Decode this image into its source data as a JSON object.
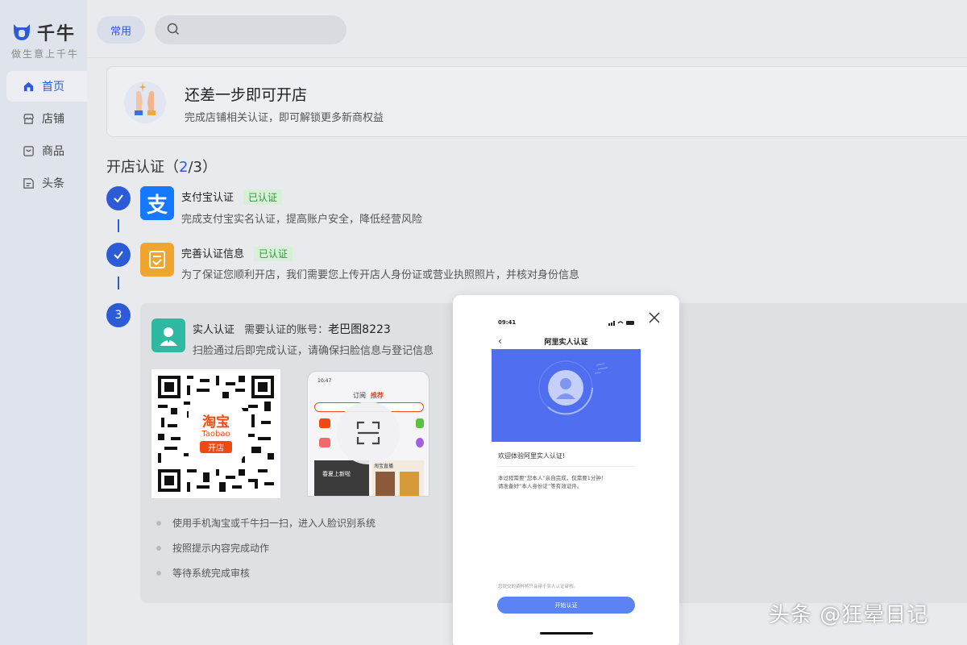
{
  "brand": {
    "name": "千牛",
    "slogan": "做生意上千牛"
  },
  "sidebar": {
    "items": [
      {
        "label": "首页",
        "icon": "home-icon",
        "active": true
      },
      {
        "label": "店铺",
        "icon": "store-icon",
        "active": false
      },
      {
        "label": "商品",
        "icon": "product-icon",
        "active": false
      },
      {
        "label": "头条",
        "icon": "news-icon",
        "active": false
      }
    ]
  },
  "topbar": {
    "chip_label": "常用",
    "search_value": ""
  },
  "banner": {
    "title": "还差一步即可开店",
    "subtitle": "完成店铺相关认证，即可解锁更多新商权益"
  },
  "section": {
    "title_prefix": "开店认证（",
    "done": "2",
    "title_suffix": "/3）"
  },
  "steps": [
    {
      "title": "支付宝认证",
      "badge": "已认证",
      "desc": "完成支付宝实名认证，提高账户安全，降低经营风险",
      "icon_glyph": "支"
    },
    {
      "title": "完善认证信息",
      "badge": "已认证",
      "desc": "为了保证您顺利开店，我们需要您上传开店人身份证或营业执照照片，并核对身份信息"
    },
    {
      "number": "3",
      "title": "实人认证",
      "account_label": "需要认证的账号：",
      "account": "老巴图8223",
      "desc": "扫脸通过后即完成认证，请确保扫脸信息与登记信息"
    }
  ],
  "qr": {
    "logo_cn": "淘宝",
    "logo_en": "Taobao",
    "logo_tag": "开店"
  },
  "phone_mock": {
    "time": "10:47",
    "tab1": "订阅",
    "tab2": "推荐",
    "banner_text": "春夏上新啦",
    "live": "淘宝直播"
  },
  "tips": [
    "使用手机淘宝或千牛扫一扫，进入人脸识别系统",
    "按照提示内容完成动作",
    "等待系统完成审核"
  ],
  "modal": {
    "status_time": "09:41",
    "title": "阿里实人认证",
    "welcome": "欢迎体验阿里实人认证!",
    "line1": "本过程需要“您本人”亲自完成，仅需要1分钟！",
    "line2": "请准备好“本人身份证”等有效证件。",
    "note": "您提交的资料将只会用于实人认证审核。",
    "button": "开始认证"
  },
  "watermark": "头条 @狂晕日记",
  "colors": {
    "accent": "#2d5bd6",
    "success_bg": "#d8efd8",
    "success_text": "#2e9a3a",
    "alipay": "#1677ff",
    "taobao": "#f04a12"
  }
}
